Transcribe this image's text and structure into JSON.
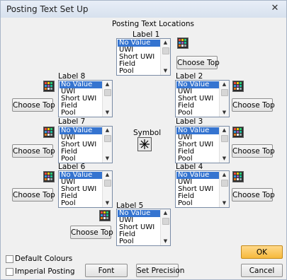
{
  "window": {
    "title": "Posting Text Set Up",
    "close_glyph": "✕"
  },
  "section_title": "Posting Text Locations",
  "list_items": [
    "No Value",
    "UWI",
    "Short UWI",
    "Field",
    "Pool"
  ],
  "labels": {
    "label1": "Label 1",
    "label2": "Label 2",
    "label3": "Label 3",
    "label4": "Label 4",
    "label5": "Label 5",
    "label6": "Label 6",
    "label7": "Label 7",
    "label8": "Label 8"
  },
  "choose_top": "Choose Top",
  "symbol_label": "Symbol",
  "checkboxes": {
    "default_colours": "Default Colours",
    "imperial_posting": "Imperial Posting"
  },
  "buttons": {
    "font": "Font",
    "set_precision": "Set Precision",
    "ok": "OK",
    "cancel": "Cancel"
  },
  "icons": {
    "grid": "grid-icon",
    "symbol": "asterisk-symbol-icon"
  },
  "colors": {
    "selection": "#3574d0",
    "ok_button": "#f6b93c"
  }
}
